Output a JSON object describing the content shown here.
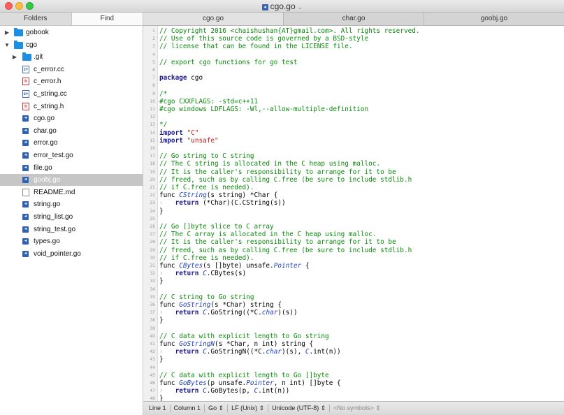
{
  "window": {
    "title": "cgo.go",
    "file_icon": "go-file-icon"
  },
  "sidebar": {
    "tabs": [
      {
        "label": "Folders"
      },
      {
        "label": "Find"
      }
    ],
    "tree": [
      {
        "label": "gobook",
        "type": "folder",
        "state": "collapsed",
        "depth": 0
      },
      {
        "label": "cgo",
        "type": "folder",
        "state": "expanded",
        "depth": 0
      },
      {
        "label": ".git",
        "type": "folder",
        "state": "collapsed",
        "depth": 1
      },
      {
        "label": "c_error.cc",
        "type": "cc",
        "depth": 1
      },
      {
        "label": "c_error.h",
        "type": "h",
        "depth": 1
      },
      {
        "label": "c_string.cc",
        "type": "cc",
        "depth": 1
      },
      {
        "label": "c_string.h",
        "type": "h",
        "depth": 1
      },
      {
        "label": "cgo.go",
        "type": "go",
        "depth": 1
      },
      {
        "label": "char.go",
        "type": "go",
        "depth": 1
      },
      {
        "label": "error.go",
        "type": "go",
        "depth": 1
      },
      {
        "label": "error_test.go",
        "type": "go",
        "depth": 1
      },
      {
        "label": "file.go",
        "type": "go",
        "depth": 1
      },
      {
        "label": "goobj.go",
        "type": "go",
        "depth": 1,
        "selected": true
      },
      {
        "label": "README.md",
        "type": "md",
        "depth": 1
      },
      {
        "label": "string.go",
        "type": "go",
        "depth": 1
      },
      {
        "label": "string_list.go",
        "type": "go",
        "depth": 1
      },
      {
        "label": "string_test.go",
        "type": "go",
        "depth": 1
      },
      {
        "label": "types.go",
        "type": "go",
        "depth": 1
      },
      {
        "label": "void_pointer.go",
        "type": "go",
        "depth": 1
      }
    ]
  },
  "tabs": [
    {
      "label": "cgo.go",
      "active": true
    },
    {
      "label": "char.go"
    },
    {
      "label": "goobj.go"
    }
  ],
  "editor": {
    "lines": [
      [
        [
          "com",
          "// Copyright 2016 <chaishushan{AT}gmail.com>. All rights reserved."
        ]
      ],
      [
        [
          "com",
          "// Use of this source code is governed by a BSD-style"
        ]
      ],
      [
        [
          "com",
          "// license that can be found in the LICENSE file."
        ]
      ],
      [],
      [
        [
          "com",
          "// export cgo functions for go test"
        ]
      ],
      [],
      [
        [
          "kw",
          "package"
        ],
        [
          "txt",
          " cgo"
        ]
      ],
      [],
      [
        [
          "com",
          "/*"
        ]
      ],
      [
        [
          "pre",
          "#cgo CXXFLAGS: -std=c++11"
        ]
      ],
      [
        [
          "pre",
          "#cgo windows LDFLAGS: -Wl,--allow-multiple-definition"
        ]
      ],
      [],
      [
        [
          "com",
          "*/"
        ]
      ],
      [
        [
          "kw",
          "import"
        ],
        [
          "txt",
          " "
        ],
        [
          "str",
          "\"C\""
        ]
      ],
      [
        [
          "kw",
          "import"
        ],
        [
          "txt",
          " "
        ],
        [
          "str",
          "\"unsafe\""
        ]
      ],
      [],
      [
        [
          "com",
          "// Go string to C string"
        ]
      ],
      [
        [
          "com",
          "// The C string is allocated in the C heap using malloc."
        ]
      ],
      [
        [
          "com",
          "// It is the caller's responsibility to arrange for it to be"
        ]
      ],
      [
        [
          "com",
          "// freed, such as by calling C.free (be sure to include stdlib.h"
        ]
      ],
      [
        [
          "com",
          "// if C.free is needed)."
        ]
      ],
      [
        [
          "txt",
          "func "
        ],
        [
          "fn",
          "CString"
        ],
        [
          "txt",
          "(s string) *Char {"
        ]
      ],
      [
        [
          "tab",
          "›   "
        ],
        [
          "kw",
          "return"
        ],
        [
          "txt",
          " (*Char)(C.CString(s))"
        ]
      ],
      [
        [
          "txt",
          "}"
        ]
      ],
      [],
      [
        [
          "com",
          "// Go []byte slice to C array"
        ]
      ],
      [
        [
          "com",
          "// The C array is allocated in the C heap using malloc."
        ]
      ],
      [
        [
          "com",
          "// It is the caller's responsibility to arrange for it to be"
        ]
      ],
      [
        [
          "com",
          "// freed, such as by calling C.free (be sure to include stdlib.h"
        ]
      ],
      [
        [
          "com",
          "// if C.free is needed)."
        ]
      ],
      [
        [
          "txt",
          "func "
        ],
        [
          "fn",
          "CBytes"
        ],
        [
          "txt",
          "(s []byte) unsafe."
        ],
        [
          "fn",
          "Pointer"
        ],
        [
          "txt",
          " {"
        ]
      ],
      [
        [
          "tab",
          "›   "
        ],
        [
          "kw",
          "return"
        ],
        [
          "txt",
          " "
        ],
        [
          "fn",
          "C"
        ],
        [
          "txt",
          ".CBytes(s)"
        ]
      ],
      [
        [
          "txt",
          "}"
        ]
      ],
      [],
      [
        [
          "com",
          "// C string to Go string"
        ]
      ],
      [
        [
          "txt",
          "func "
        ],
        [
          "fn",
          "GoString"
        ],
        [
          "txt",
          "(s *Char) string {"
        ]
      ],
      [
        [
          "tab",
          "›   "
        ],
        [
          "kw",
          "return"
        ],
        [
          "txt",
          " "
        ],
        [
          "fn",
          "C"
        ],
        [
          "txt",
          ".GoString((*C."
        ],
        [
          "fn",
          "char"
        ],
        [
          "txt",
          ")(s))"
        ]
      ],
      [
        [
          "txt",
          "}"
        ]
      ],
      [],
      [
        [
          "com",
          "// C data with explicit length to Go string"
        ]
      ],
      [
        [
          "txt",
          "func "
        ],
        [
          "fn",
          "GoStringN"
        ],
        [
          "txt",
          "(s *Char, n int) string {"
        ]
      ],
      [
        [
          "tab",
          "›   "
        ],
        [
          "kw",
          "return"
        ],
        [
          "txt",
          " "
        ],
        [
          "fn",
          "C"
        ],
        [
          "txt",
          ".GoStringN((*C."
        ],
        [
          "fn",
          "char"
        ],
        [
          "txt",
          ")(s), "
        ],
        [
          "fn",
          "C"
        ],
        [
          "txt",
          ".int(n))"
        ]
      ],
      [
        [
          "txt",
          "}"
        ]
      ],
      [],
      [
        [
          "com",
          "// C data with explicit length to Go []byte"
        ]
      ],
      [
        [
          "txt",
          "func "
        ],
        [
          "fn",
          "GoBytes"
        ],
        [
          "txt",
          "(p unsafe."
        ],
        [
          "fn",
          "Pointer"
        ],
        [
          "txt",
          ", n int) []byte {"
        ]
      ],
      [
        [
          "tab",
          "›   "
        ],
        [
          "kw",
          "return"
        ],
        [
          "txt",
          " "
        ],
        [
          "fn",
          "C"
        ],
        [
          "txt",
          ".GoBytes(p, "
        ],
        [
          "fn",
          "C"
        ],
        [
          "txt",
          ".int(n))"
        ]
      ],
      [
        [
          "txt",
          "}"
        ]
      ]
    ]
  },
  "status": {
    "line": "Line 1",
    "column": "Column 1",
    "syntax": "Go",
    "line_endings": "LF (Unix)",
    "encoding": "Unicode (UTF-8)",
    "symbols": "<No symbols>"
  }
}
